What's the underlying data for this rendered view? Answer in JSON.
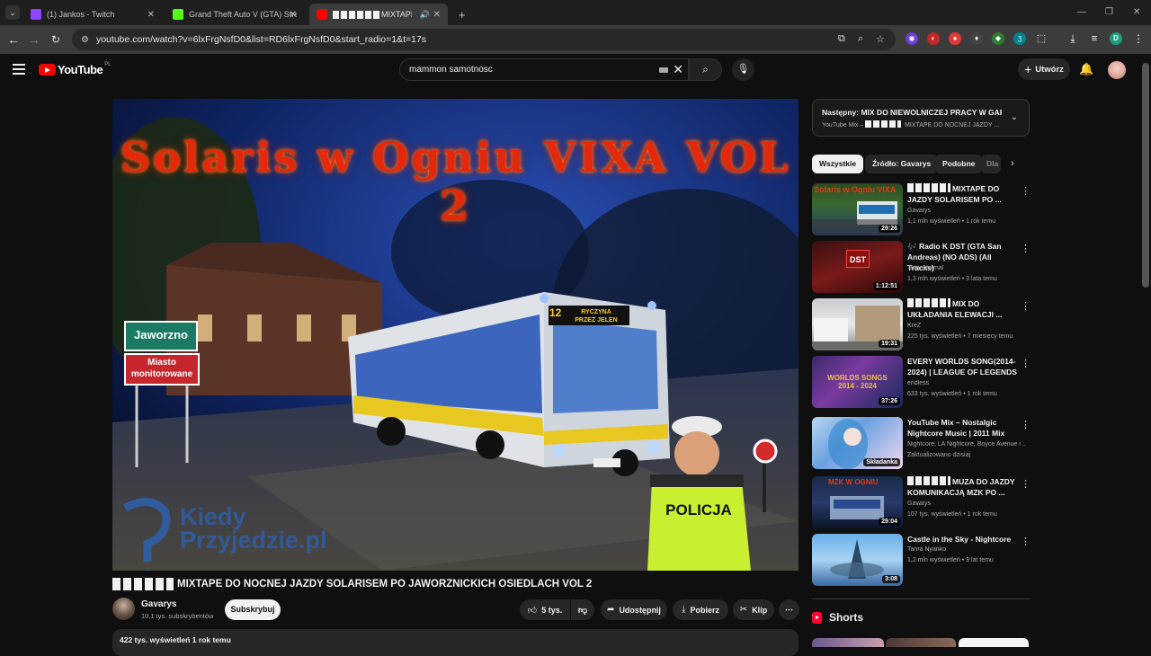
{
  "browser": {
    "tabs": [
      {
        "title": "(1) Jankos - Twitch",
        "color": "#9146ff"
      },
      {
        "title": "Grand Theft Auto V (GTA) Strea",
        "color": "#53fc18"
      },
      {
        "title": "MIXTAPE DO",
        "color": "#ff0000"
      }
    ],
    "tab_close": "✕",
    "new_tab": "+",
    "url": "youtube.com/watch?v=6lxFrgNsfD0&list=RD6lxFrgNsfD0&start_radio=1&t=17s",
    "window_controls": [
      "—",
      "❐",
      "✕"
    ]
  },
  "youtube": {
    "logo_text": "YouTube",
    "region": "PL",
    "search_value": "mammon samotnosc",
    "create_label": "Utwórz"
  },
  "video": {
    "title": "MIXTAPE DO NOCNEJ JAZDY SOLARISEM PO JAWORZNICKICH OSIEDLACH VOL 2",
    "thumb_text": "Solaris w Ogniu VIXA VOL 2",
    "sign_top": "Jaworzno",
    "sign_bottom_1": "Miasto",
    "sign_bottom_2": "monitorowane",
    "police_text": "POLICJA",
    "bus_display_1": "RYCZYNA",
    "bus_display_2": "PRZEZ JELEN",
    "bus_number": "12",
    "watermark_1": "Kiedy",
    "watermark_2": "Przyjedzie.pl",
    "channel": "Gavarys",
    "subscribers": "10,1 tys. subskrybentów",
    "subscribe_label": "Subskrybuj",
    "likes": "5 tys.",
    "share_label": "Udostępnij",
    "download_label": "Pobierz",
    "clip_label": "Klip",
    "views_meta": "422 tys. wyświetleń  1 rok temu"
  },
  "up_next": {
    "title": "Następny: MIX DO NIEWOLNICZEJ PRACY W GARA...",
    "subtitle": "YouTube Mix – MIXTAPE DO NOCNEJ JAZDY ..."
  },
  "chips": [
    "Wszystkie",
    "Źródło: Gavarys",
    "Podobne",
    "Dla"
  ],
  "recommendations": [
    {
      "title": "MIXTAPE DO JAZDY SOLARISEM PO ...",
      "hit": true,
      "channel": "Gavarys",
      "meta": "1,1 mln wyświetleń • 1 rok temu",
      "duration": "29:26"
    },
    {
      "title": "🎶 Radio K DST (GTA San Andreas) (NO ADS) (All Tracks)",
      "hit": false,
      "channel": "Tutankhamal",
      "meta": "1,3 mln wyświetleń • 3 lata temu",
      "duration": "1:12:51"
    },
    {
      "title": "MIX DO UKŁADANIA ELEWACJI ...",
      "hit": true,
      "channel": "KreZ",
      "meta": "225 tys. wyświetleń • 7 miesięcy temu",
      "duration": "19:31"
    },
    {
      "title": "EVERY WORLDS SONG(2014-2024) | LEAGUE OF LEGENDS",
      "hit": false,
      "channel": "endless",
      "meta": "633 tys. wyświetleń • 1 rok temu",
      "duration": "37:26"
    },
    {
      "title": "YouTube Mix – Nostalgic Nightcore Music | 2011 Mix",
      "hit": false,
      "channel": "Nightcore, LA Nightcore, Boyce Avenue i ...",
      "meta": "Zaktualizowano dzisiaj",
      "duration": "Składanka"
    },
    {
      "title": "MUZA DO JAZDY KOMUNIKACJĄ MZK PO ...",
      "hit": true,
      "channel": "Gavarys",
      "meta": "107 tys. wyświetleń • 1 rok temu",
      "duration": "29:04"
    },
    {
      "title": "Castle in the Sky - Nightcore",
      "hit": false,
      "channel": "Tanra Nyanko",
      "meta": "1,2 mln wyświetleń • 9 lat temu",
      "duration": "3:08"
    }
  ],
  "shorts_label": "Shorts"
}
